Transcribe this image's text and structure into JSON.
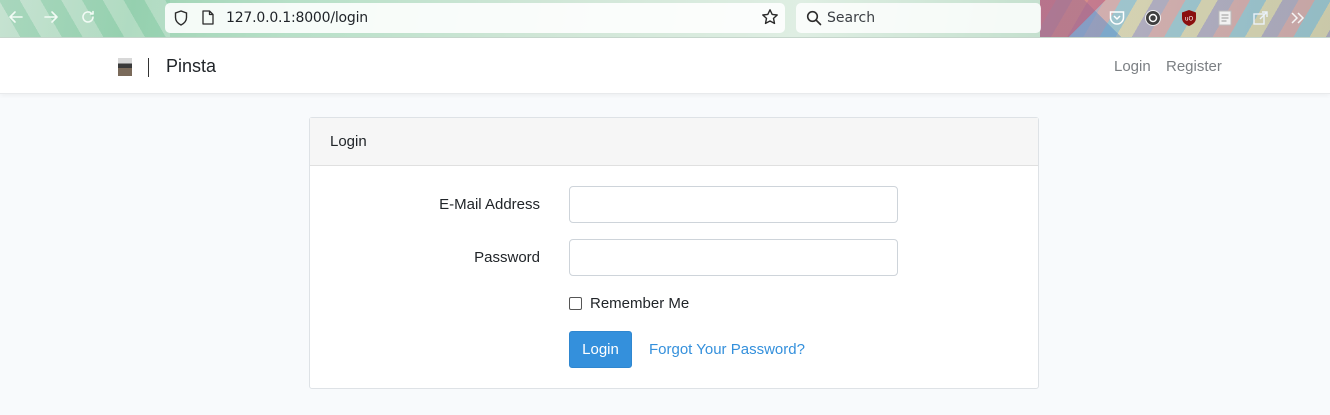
{
  "browser": {
    "url": "127.0.0.1:8000/login",
    "search_placeholder": "Search"
  },
  "navbar": {
    "brand": "Pinsta",
    "links": [
      "Login",
      "Register"
    ]
  },
  "card": {
    "header": "Login",
    "email_label": "E-Mail Address",
    "email_value": "",
    "password_label": "Password",
    "password_value": "",
    "remember_label": "Remember Me",
    "remember_checked": false,
    "submit_label": "Login",
    "forgot_label": "Forgot Your Password?"
  },
  "colors": {
    "primary": "#3490dc",
    "page_bg": "#f8fafc",
    "nav_link": "#7b7f83"
  },
  "icons": [
    "back-arrow-icon",
    "forward-arrow-icon",
    "reload-icon",
    "shield-icon",
    "page-icon",
    "bookmark-star-icon",
    "search-icon",
    "pocket-icon",
    "privacy-extension-icon",
    "ublock-icon",
    "document-icon",
    "share-icon",
    "overflow-chevron-icon"
  ]
}
